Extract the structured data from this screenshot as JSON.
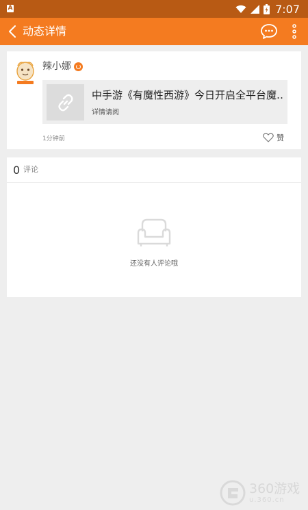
{
  "status_bar": {
    "app_badge": "A",
    "time": "7:07"
  },
  "header": {
    "title": "动态详情",
    "back_icon": "chevron-left-icon",
    "chat_icon": "chat-bubble-icon",
    "more_icon": "more-vertical-icon"
  },
  "post": {
    "username": "辣小娜",
    "link": {
      "title": "中手游《有魔性西游》今日开启全平台魔…",
      "subtitle": "详情请阅",
      "thumb_icon": "link-icon"
    },
    "time": "1分钟前",
    "like_label": "赞",
    "like_icon": "heart-outline-icon"
  },
  "comments": {
    "count": "0",
    "label": "评论",
    "empty_text": "还没有人评论哦",
    "empty_icon": "sofa-icon"
  },
  "watermark": {
    "brand": "360游戏",
    "domain": "u.360.cn"
  },
  "colors": {
    "header": "#f47b20",
    "status_bar": "#b85a14",
    "background": "#eeeeee"
  }
}
